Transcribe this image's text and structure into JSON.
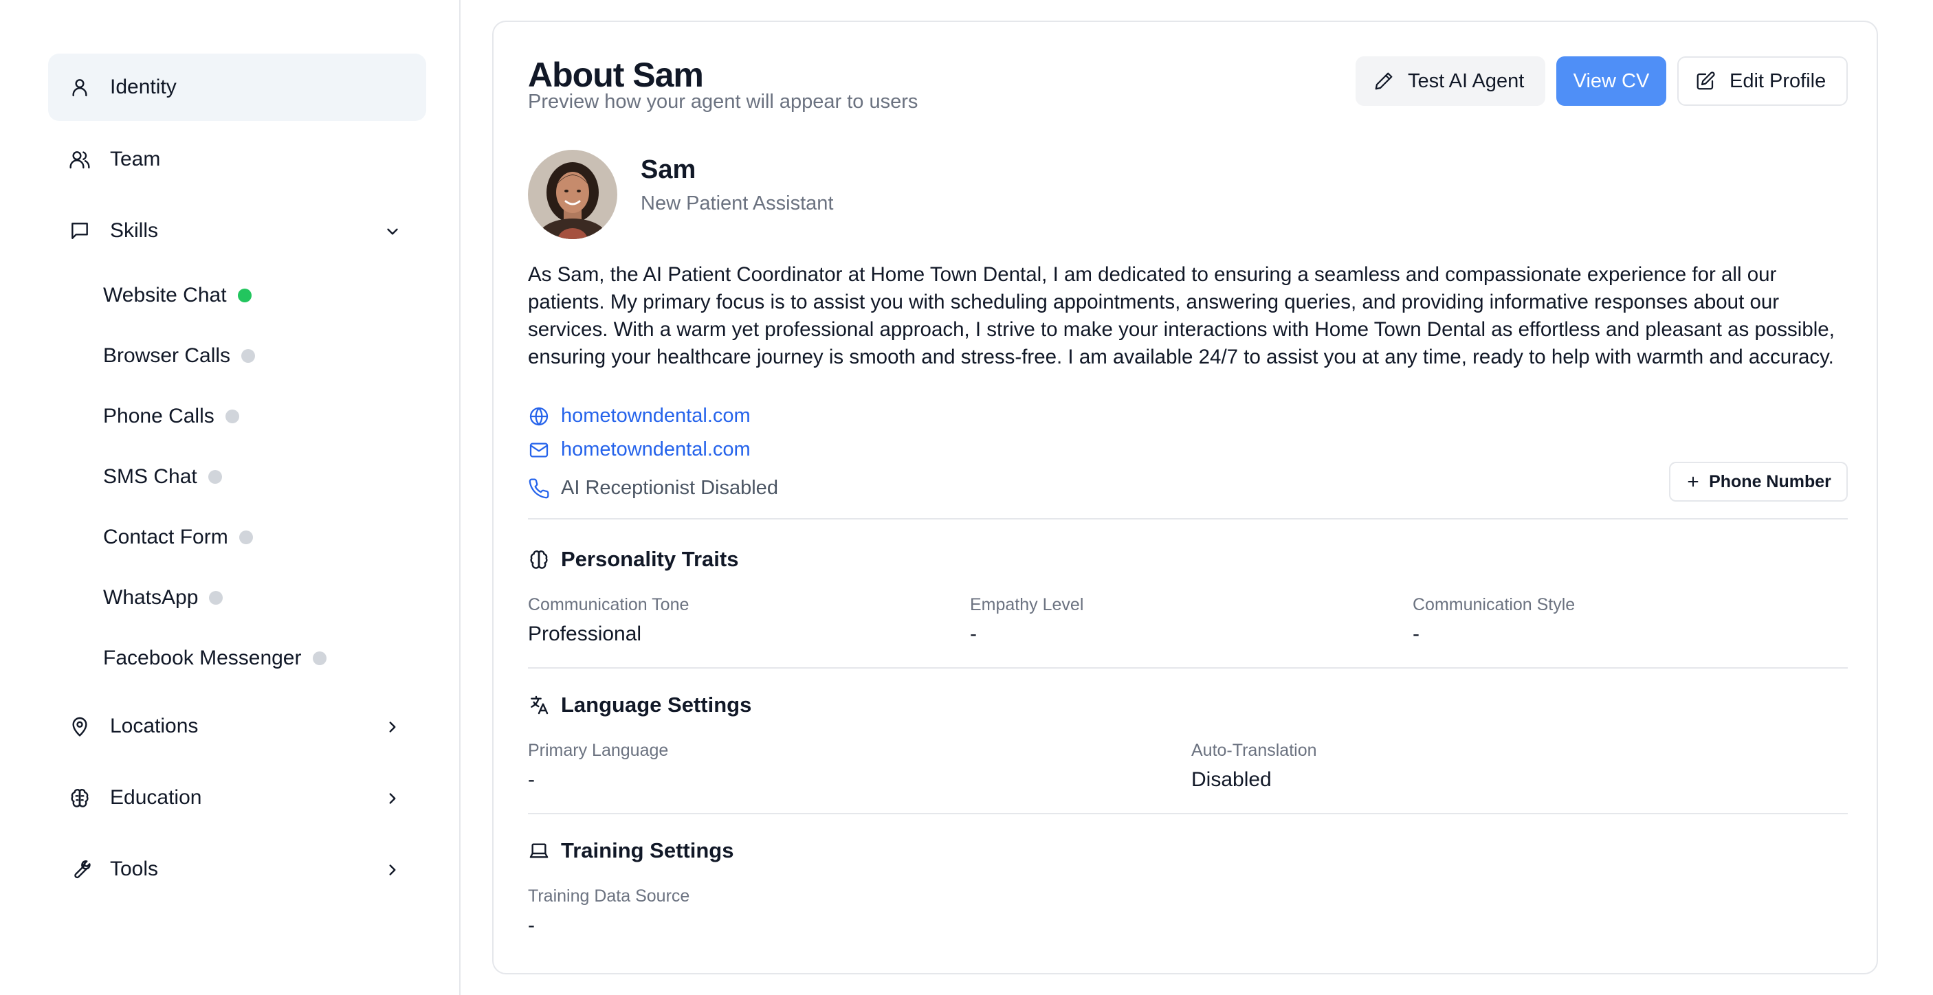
{
  "sidebar": {
    "items": [
      {
        "label": "Identity",
        "icon": "user-icon",
        "active": true
      },
      {
        "label": "Team",
        "icon": "users-icon"
      },
      {
        "label": "Skills",
        "icon": "message-square-icon",
        "expanded": true
      },
      {
        "label": "Locations",
        "icon": "map-pin-icon"
      },
      {
        "label": "Education",
        "icon": "brain-icon"
      },
      {
        "label": "Tools",
        "icon": "wrench-icon"
      }
    ],
    "skills": [
      {
        "label": "Website Chat",
        "status": "active"
      },
      {
        "label": "Browser Calls",
        "status": "inactive"
      },
      {
        "label": "Phone Calls",
        "status": "inactive"
      },
      {
        "label": "SMS Chat",
        "status": "inactive"
      },
      {
        "label": "Contact Form",
        "status": "inactive"
      },
      {
        "label": "WhatsApp",
        "status": "inactive"
      },
      {
        "label": "Facebook Messenger",
        "status": "inactive"
      }
    ]
  },
  "header": {
    "title": "About Sam",
    "subtitle": "Preview how your agent will appear to users",
    "buttons": {
      "test": "Test AI Agent",
      "cv": "View CV",
      "edit": "Edit Profile"
    }
  },
  "agent": {
    "name": "Sam",
    "role": "New Patient Assistant",
    "bio": "As Sam, the AI Patient Coordinator at Home Town Dental, I am dedicated to ensuring a seamless and compassionate experience for all our patients. My primary focus is to assist you with scheduling appointments, answering queries, and providing informative responses about our services. With a warm yet professional approach, I strive to make your interactions with Home Town Dental as effortless and pleasant as possible, ensuring your healthcare journey is smooth and stress-free. I am available 24/7 to assist you at any time, ready to help with warmth and accuracy.",
    "website": "hometowndental.com",
    "email": "hometowndental.com",
    "phone_status": "AI Receptionist Disabled",
    "add_phone_label": "Phone Number"
  },
  "personality": {
    "title": "Personality Traits",
    "fields": [
      {
        "label": "Communication Tone",
        "value": "Professional"
      },
      {
        "label": "Empathy Level",
        "value": "-"
      },
      {
        "label": "Communication Style",
        "value": "-"
      }
    ]
  },
  "language": {
    "title": "Language Settings",
    "fields": [
      {
        "label": "Primary Language",
        "value": "-"
      },
      {
        "label": "Auto-Translation",
        "value": "Disabled"
      }
    ]
  },
  "training": {
    "title": "Training Settings",
    "fields": [
      {
        "label": "Training Data Source",
        "value": "-"
      }
    ]
  },
  "colors": {
    "accent": "#4f8ff7",
    "link": "#2563eb",
    "status_active": "#22c55e",
    "status_inactive": "#d1d5db",
    "active_nav_bg": "#f1f5f9"
  }
}
